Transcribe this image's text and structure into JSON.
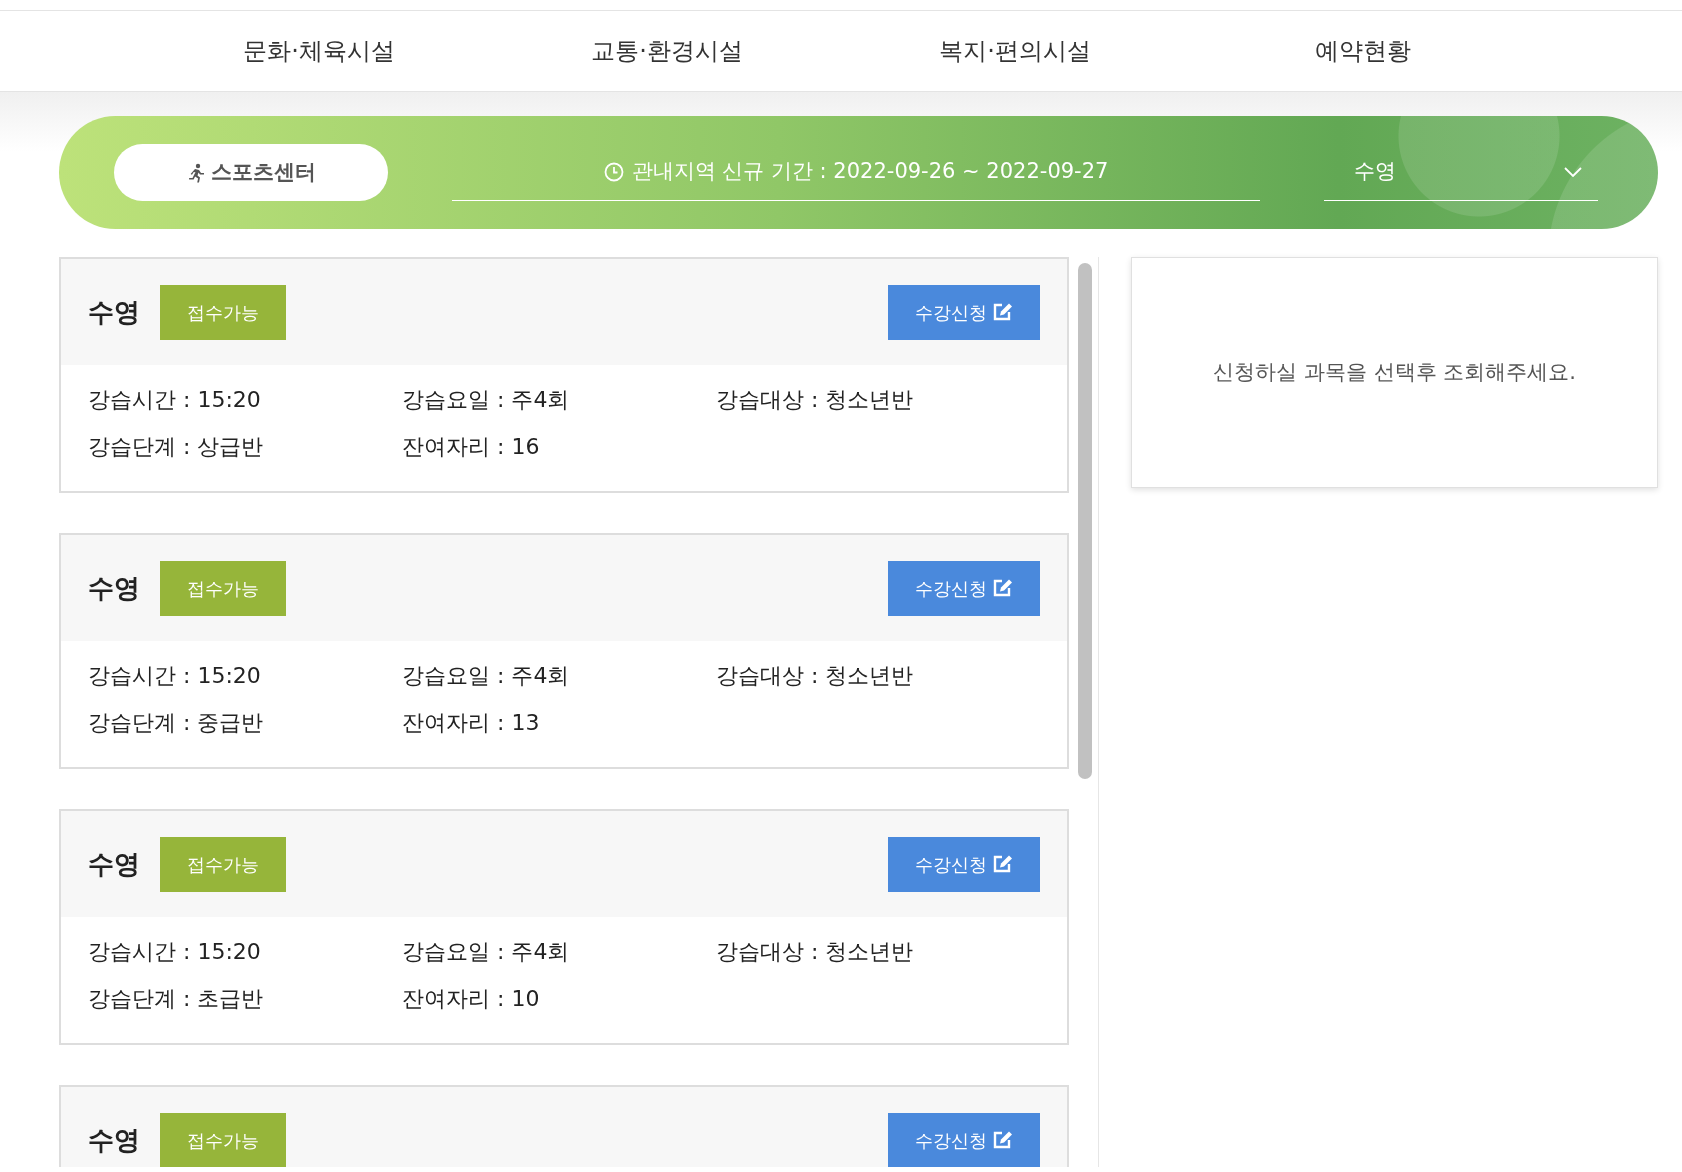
{
  "nav": [
    {
      "label": "문화·체육시설"
    },
    {
      "label": "교통·환경시설"
    },
    {
      "label": "복지·편의시설"
    },
    {
      "label": "예약현황"
    }
  ],
  "banner": {
    "facility": "스포츠센터",
    "period": "관내지역 신규 기간 : 2022-09-26 ~ 2022-09-27",
    "select": "수영"
  },
  "courses": [
    {
      "title": "수영",
      "status": "접수가능",
      "button": "수강신청",
      "fields": [
        "강습시간 : 15:20",
        "강습요일 : 주4회",
        "강습대상 : 청소년반",
        "강습단계 : 상급반",
        "잔여자리 : 16"
      ]
    },
    {
      "title": "수영",
      "status": "접수가능",
      "button": "수강신청",
      "fields": [
        "강습시간 : 15:20",
        "강습요일 : 주4회",
        "강습대상 : 청소년반",
        "강습단계 : 중급반",
        "잔여자리 : 13"
      ]
    },
    {
      "title": "수영",
      "status": "접수가능",
      "button": "수강신청",
      "fields": [
        "강습시간 : 15:20",
        "강습요일 : 주4회",
        "강습대상 : 청소년반",
        "강습단계 : 초급반",
        "잔여자리 : 10"
      ]
    },
    {
      "title": "수영",
      "status": "접수가능",
      "button": "수강신청"
    }
  ],
  "detail": {
    "message": "신청하실 과목을 선택후 조회해주세요."
  }
}
